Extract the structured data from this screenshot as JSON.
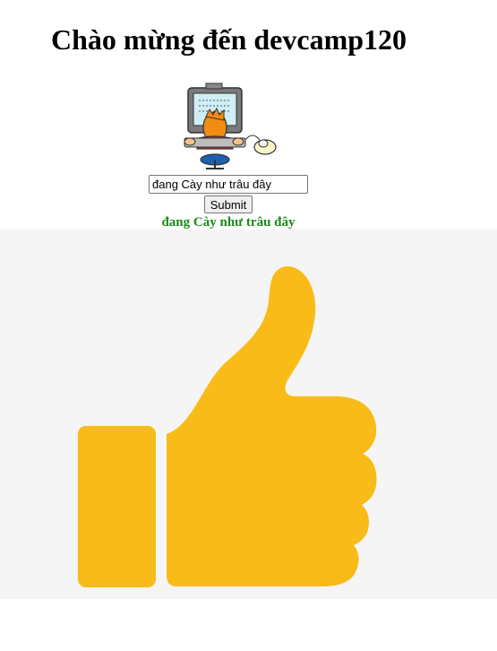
{
  "header": {
    "title": "Chào mừng đến devcamp120"
  },
  "form": {
    "input_value": "đang Cày như trâu đây",
    "submit_label": "Submit",
    "output_text": "đang Cày như trâu đây"
  },
  "colors": {
    "output_text": "#1a8a1a",
    "thumb": "#f9bb17",
    "panel_background": "#f5f5f5"
  },
  "icons": {
    "illustration": "computer-worker-icon",
    "panel_image": "thumbs-up-icon"
  }
}
